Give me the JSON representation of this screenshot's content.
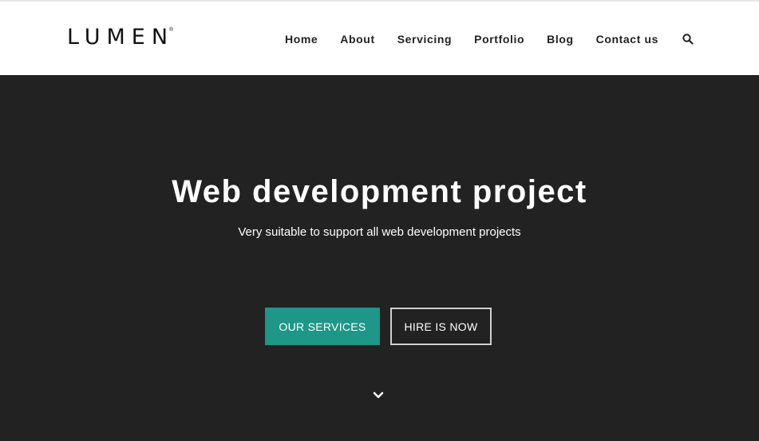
{
  "header": {
    "logo": {
      "text": "LUMEN",
      "registered": "®"
    },
    "nav": [
      {
        "label": "Home"
      },
      {
        "label": "About"
      },
      {
        "label": "Servicing"
      },
      {
        "label": "Portfolio"
      },
      {
        "label": "Blog"
      },
      {
        "label": "Contact us"
      }
    ],
    "search_icon": "search-icon"
  },
  "hero": {
    "title": "Web development project",
    "subtitle": "Very suitable to support all web development projects",
    "primary_button": "OUR SERVICES",
    "secondary_button": "HIRE IS NOW",
    "scroll_icon": "chevron-down-icon"
  },
  "colors": {
    "hero_background": "#222222",
    "accent": "#1e9688",
    "text_light": "#ffffff",
    "nav_text": "#222222"
  }
}
